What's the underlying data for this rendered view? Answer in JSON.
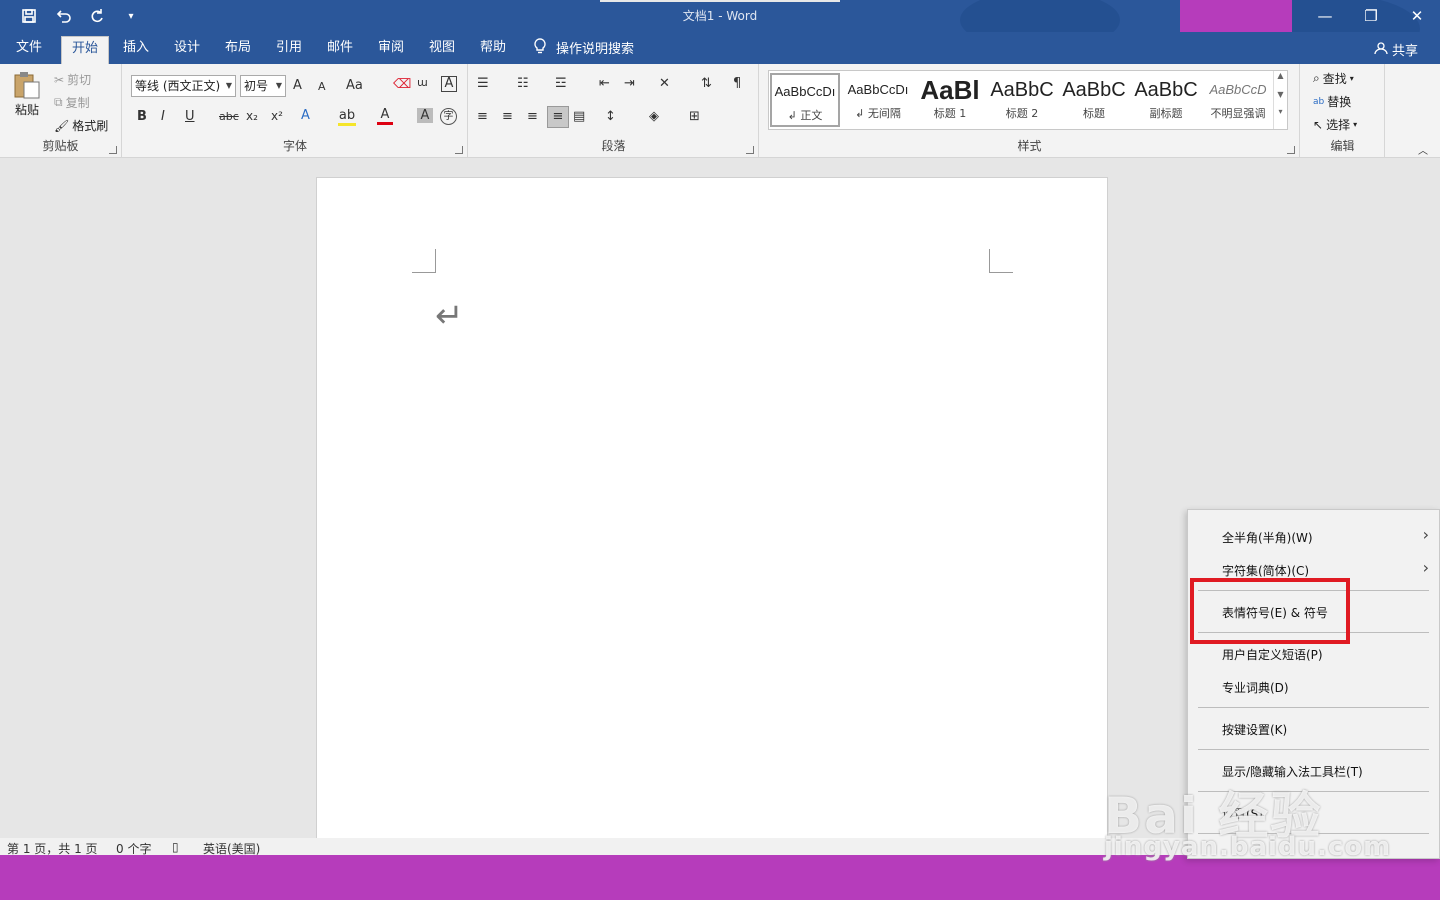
{
  "window": {
    "title": "文档1  -  Word",
    "min_icon": "—",
    "restore_icon": "❐",
    "close_icon": "✕"
  },
  "qat": {
    "save": "save-icon",
    "undo": "undo-icon",
    "redo": "redo-icon",
    "customize": "customize-icon"
  },
  "tabs": [
    "文件",
    "开始",
    "插入",
    "设计",
    "布局",
    "引用",
    "邮件",
    "审阅",
    "视图",
    "帮助"
  ],
  "active_tab": "开始",
  "tell_me": "操作说明搜索",
  "share": "共享",
  "clipboard": {
    "label": "剪贴板",
    "paste": "粘贴",
    "cut": "剪切",
    "copy": "复制",
    "format_painter": "格式刷"
  },
  "font": {
    "label": "字体",
    "family": "等线 (西文正文)",
    "size": "初号",
    "grow": "A",
    "shrink": "A",
    "case": "Aa",
    "bold": "B",
    "italic": "I",
    "underline": "U",
    "strike": "abc",
    "sub": "x₂",
    "sup": "x²",
    "effects": "A",
    "highlight": "ab",
    "color": "A",
    "shading": "A",
    "enclose": "字"
  },
  "paragraph": {
    "label": "段落"
  },
  "styles": {
    "label": "样式",
    "items": [
      {
        "preview": "AaBbCcDı",
        "name": "↲ 正文"
      },
      {
        "preview": "AaBbCcDı",
        "name": "↲ 无间隔"
      },
      {
        "preview": "AaBl",
        "name": "标题 1"
      },
      {
        "preview": "AaBbC",
        "name": "标题 2"
      },
      {
        "preview": "AaBbC",
        "name": "标题"
      },
      {
        "preview": "AaBbC",
        "name": "副标题"
      },
      {
        "preview": "AaBbCcD",
        "name": "不明显强调"
      }
    ]
  },
  "editing": {
    "label": "编辑",
    "find": "查找",
    "replace": "替换",
    "select": "选择"
  },
  "document": {
    "paragraph_mark": "↵"
  },
  "status": {
    "page": "第 1 页，共 1 页",
    "words": "0 个字",
    "language": "英语(美国)"
  },
  "context_menu": {
    "items": [
      {
        "label": "全半角(半角)(W)",
        "submenu": true
      },
      {
        "label": "字符集(简体)(C)",
        "submenu": true
      },
      {
        "label": "表情符号(E) & 符号",
        "submenu": false
      },
      {
        "label": "用户自定义短语(P)",
        "submenu": false
      },
      {
        "label": "专业词典(D)",
        "submenu": false
      },
      {
        "label": "按键设置(K)",
        "submenu": false
      },
      {
        "label": "显示/隐藏输入法工具栏(T)",
        "submenu": false
      },
      {
        "label": "设置(S)",
        "submenu": false
      }
    ],
    "highlight_color": "#e01b23"
  },
  "watermark": {
    "line1": "Bai 经验",
    "line2": "jingyan.baidu.com"
  },
  "colors": {
    "title_bar": "#2b579a",
    "band": "#b63cbb",
    "highlight": "#e01b23"
  }
}
